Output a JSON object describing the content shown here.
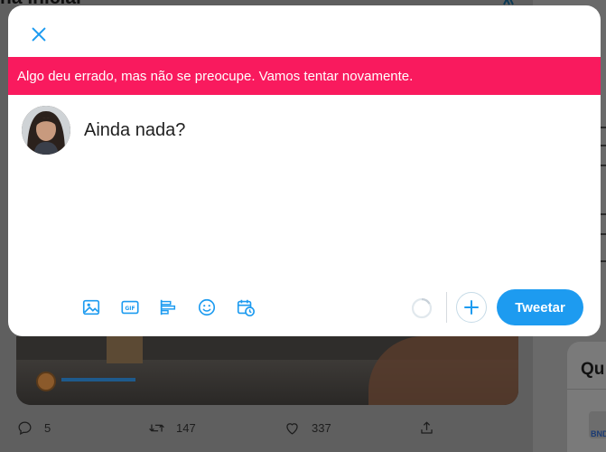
{
  "background": {
    "heading": "na inicial",
    "right_card_title": "Qu",
    "right_logo_text": "BND",
    "tweet_actions": {
      "replies": "5",
      "retweets": "147",
      "likes": "337"
    }
  },
  "modal": {
    "close_icon": "close-icon",
    "error_message": "Algo deu errado, mas não se preocupe. Vamos tentar novamente.",
    "compose_placeholder": "Ainda nada?",
    "compose_value": "",
    "toolbar_icons": [
      "image-icon",
      "gif-icon",
      "poll-icon",
      "emoji-icon",
      "schedule-icon"
    ],
    "character_progress": 0,
    "add_icon": "plus-icon",
    "tweet_label": "Tweetar"
  },
  "colors": {
    "accent": "#1d9bf0",
    "error": "#f91a5e",
    "overlay": "#5f5f5f"
  }
}
